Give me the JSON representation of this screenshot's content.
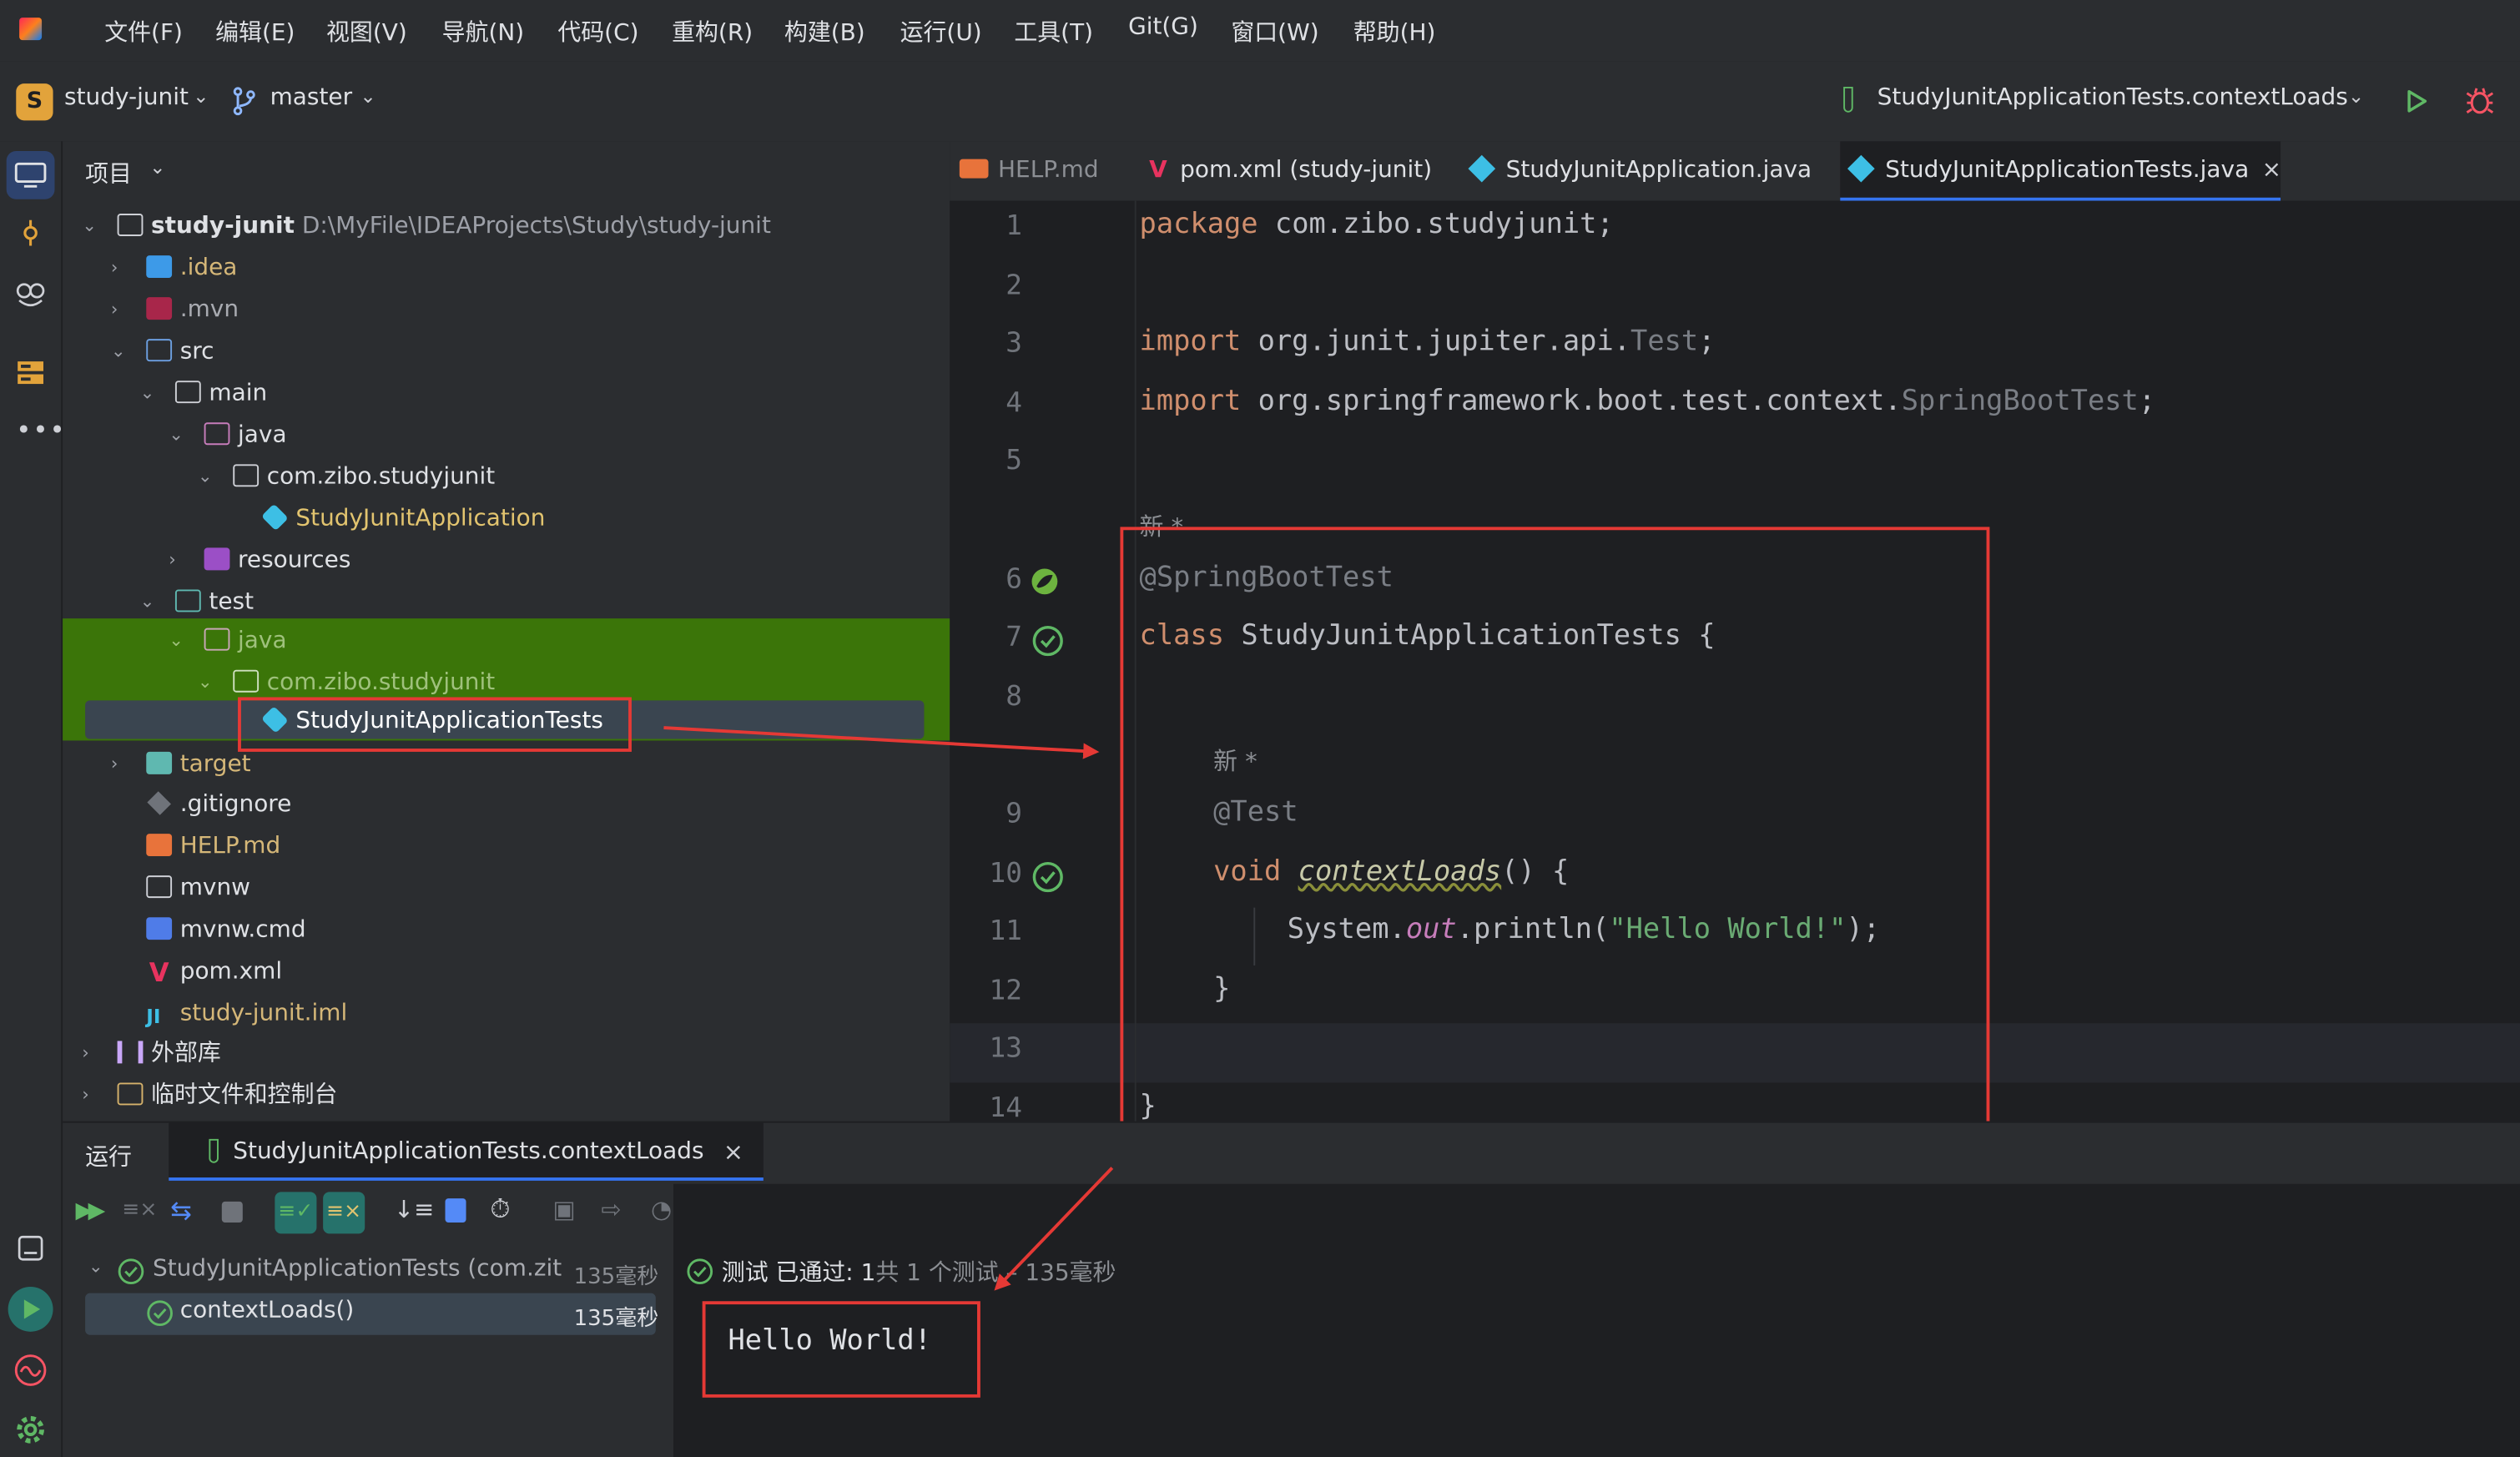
{
  "menu": [
    "文件(F)",
    "编辑(E)",
    "视图(V)",
    "导航(N)",
    "代码(C)",
    "重构(R)",
    "构建(B)",
    "运行(U)",
    "工具(T)",
    "Git(G)",
    "窗口(W)",
    "帮助(H)"
  ],
  "toolbar": {
    "project_letter": "S",
    "project_name": "study-junit",
    "branch": "master",
    "run_config": "StudyJunitApplicationTests.contextLoads"
  },
  "panel": {
    "title": "项目"
  },
  "tree": {
    "root_name": "study-junit",
    "root_path": "D:\\MyFile\\IDEAProjects\\Study\\study-junit",
    "idea": ".idea",
    "mvn": ".mvn",
    "src": "src",
    "main": "main",
    "java": "java",
    "pkg": "com.zibo.studyjunit",
    "app_class": "StudyJunitApplication",
    "resources": "resources",
    "test": "test",
    "test_java": "java",
    "test_pkg": "com.zibo.studyjunit",
    "test_class": "StudyJunitApplicationTests",
    "target": "target",
    "gitignore": ".gitignore",
    "help": "HELP.md",
    "mvnw": "mvnw",
    "mvnw_cmd": "mvnw.cmd",
    "pom": "pom.xml",
    "iml": "study-junit.iml",
    "ext_libs": "外部库",
    "scratches": "临时文件和控制台"
  },
  "tabs": [
    "HELP.md",
    "pom.xml (study-junit)",
    "StudyJunitApplication.java",
    "StudyJunitApplicationTests.java"
  ],
  "code": {
    "l1_kw": "package",
    "l1_rest": " com.zibo.studyjunit;",
    "l3_kw": "import",
    "l3_pkg": " org.junit.jupiter.api.",
    "l3_cls": "Test",
    "l3_end": ";",
    "l4_kw": "import",
    "l4_pkg": " org.springframework.boot.test.context.",
    "l4_cls": "SpringBootTest",
    "l4_end": ";",
    "hint1": "新 *",
    "l6": "@SpringBootTest",
    "l7_kw": "class",
    "l7_rest": " StudyJunitApplicationTests {",
    "hint2": "新 *",
    "l9": "@Test",
    "l10_kw": "void",
    "l10_fn": "contextLoads",
    "l10_rest": "() {",
    "l11_a": "System.",
    "l11_b": "out",
    "l11_c": ".println(",
    "l11_str": "\"Hello World!\"",
    "l11_d": ");",
    "l12": "}",
    "l14": "}"
  },
  "lines": [
    "1",
    "2",
    "3",
    "4",
    "5",
    "6",
    "7",
    "8",
    "9",
    "10",
    "11",
    "12",
    "13",
    "14"
  ],
  "run": {
    "tab_label": "运行",
    "config_label": "StudyJunitApplicationTests.contextLoads",
    "suite": "StudyJunitApplicationTests (com.zit",
    "suite_time": "135毫秒",
    "test": "contextLoads()",
    "test_time": "135毫秒",
    "status_a": "测试 已通过:",
    "status_b": "1",
    "status_c": "共 1 个测试 – 135毫秒",
    "output": "Hello World!"
  },
  "colors": {
    "accent_green": "#5fb865",
    "selection_green": "#3b7509",
    "red_marker": "#e53935"
  }
}
